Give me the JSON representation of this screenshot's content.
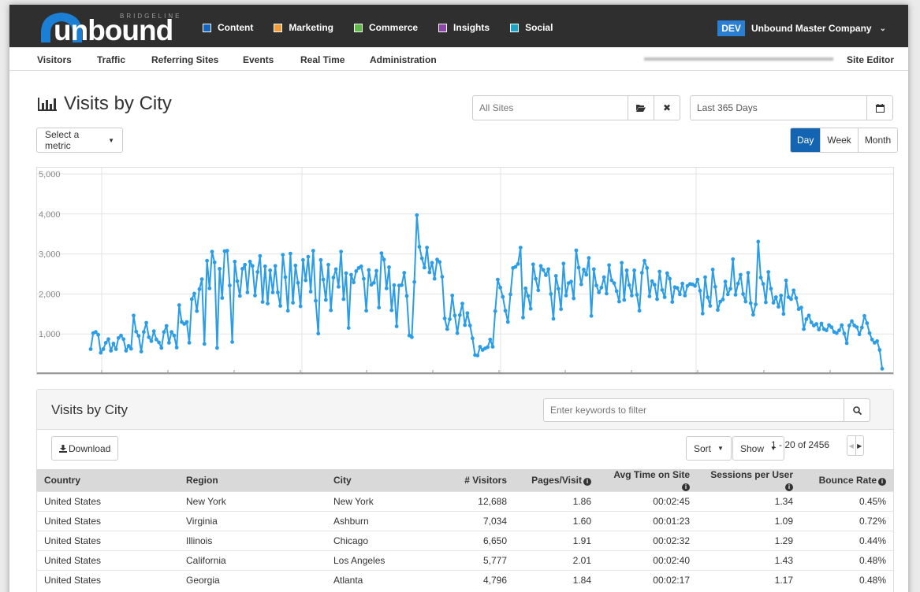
{
  "brand": {
    "name": "unbound",
    "sub": "BRIDGELINE"
  },
  "topnav": [
    {
      "label": "Content",
      "color": "#1565c0"
    },
    {
      "label": "Marketing",
      "color": "#f39c3c"
    },
    {
      "label": "Commerce",
      "color": "#5fba47"
    },
    {
      "label": "Insights",
      "color": "#8e44ad"
    },
    {
      "label": "Social",
      "color": "#1fa2c8"
    }
  ],
  "company": {
    "badge": "DEV",
    "name": "Unbound Master Company"
  },
  "subnav": {
    "items": [
      "Visitors",
      "Traffic",
      "Referring Sites",
      "Events",
      "Real Time",
      "Administration"
    ],
    "right": "Site Editor"
  },
  "page": {
    "title": "Visits by City"
  },
  "filters": {
    "sites_placeholder": "All Sites",
    "date_range": "Last 365 Days",
    "metric_label": "Select a metric",
    "granularity": [
      "Day",
      "Week",
      "Month"
    ],
    "granularity_selected": "Day"
  },
  "chart_data": {
    "type": "line",
    "ylim": [
      0,
      5000
    ],
    "yticks": [
      "1,000",
      "2,000",
      "3,000",
      "4,000",
      "5,000"
    ],
    "series": [
      {
        "values": [
          620,
          1020,
          1050,
          980,
          530,
          620,
          780,
          870,
          580,
          760,
          620,
          900,
          960,
          870,
          580,
          700,
          630,
          1460,
          1060,
          950,
          560,
          1050,
          1280,
          920,
          820,
          1070,
          860,
          790,
          650,
          1050,
          1200,
          780,
          1050,
          960,
          660,
          1720,
          1300,
          1250,
          1300,
          780,
          1870,
          2010,
          1570,
          2120,
          2370,
          750,
          2830,
          2140,
          3060,
          2790,
          650,
          2630,
          1900,
          3070,
          3080,
          2210,
          800,
          2810,
          2320,
          1950,
          2630,
          2730,
          2040,
          2810,
          2700,
          1960,
          2550,
          2950,
          1800,
          2690,
          1760,
          2590,
          2040,
          2700,
          2040,
          1700,
          2980,
          2420,
          1580,
          3010,
          1780,
          2710,
          2280,
          1690,
          2850,
          2340,
          2930,
          2060,
          3080,
          1830,
          1010,
          2850,
          2360,
          1850,
          2730,
          1590,
          2410,
          2620,
          2180,
          3060,
          1870,
          2520,
          1150,
          2480,
          2290,
          2570,
          2650,
          2690,
          2380,
          1580,
          2600,
          2230,
          2280,
          2580,
          1660,
          3020,
          2860,
          2140,
          2670,
          1590,
          2220,
          1190,
          2210,
          2220,
          2530,
          1950,
          960,
          920,
          2300,
          3970,
          3180,
          2890,
          2660,
          3160,
          2540,
          2780,
          2380,
          2860,
          2800,
          2430,
          1390,
          1120,
          1370,
          1960,
          1460,
          1020,
          1470,
          1760,
          1220,
          1520,
          1210,
          890,
          470,
          460,
          680,
          600,
          640,
          670,
          860,
          680,
          1570,
          2360,
          2160,
          1930,
          1580,
          1300,
          1990,
          2650,
          2680,
          2750,
          3160,
          1410,
          2140,
          1950,
          1630,
          2740,
          2380,
          2090,
          2700,
          2600,
          2470,
          2620,
          2000,
          1380,
          2450,
          2130,
          1620,
          2760,
          1960,
          2270,
          2310,
          1890,
          3090,
          2660,
          2240,
          2610,
          2480,
          2900,
          1450,
          2620,
          2210,
          2040,
          2160,
          2420,
          2010,
          2720,
          2340,
          2270,
          2070,
          1810,
          2780,
          1850,
          2590,
          2220,
          1960,
          2590,
          1980,
          1580,
          2530,
          2830,
          2650,
          1940,
          2320,
          2230,
          1870,
          2560,
          2100,
          1920,
          2520,
          2380,
          1800,
          2170,
          2150,
          1990,
          2260,
          1960,
          2200,
          2250,
          2240,
          2200,
          2360,
          2080,
          1510,
          2420,
          1920,
          1700,
          2610,
          2180,
          1600,
          1810,
          1860,
          2310,
          1990,
          2130,
          2870,
          1980,
          2260,
          2480,
          2000,
          1810,
          2530,
          1770,
          1480,
          1740,
          3310,
          2410,
          2250,
          1790,
          2550,
          2130,
          1780,
          1920,
          1680,
          1960,
          1500,
          2340,
          1920,
          1870,
          2090,
          1900,
          1620,
          1660,
          1120,
          1370,
          1460,
          1290,
          1210,
          1250,
          1110,
          1260,
          1120,
          1090,
          1220,
          1170,
          1050,
          1020,
          1090,
          1220,
          1010,
          770,
          1210,
          1320,
          1210,
          1170,
          990,
          1160,
          1450,
          1270,
          1020,
          860,
          780,
          820,
          600,
          130
        ]
      }
    ]
  },
  "table": {
    "title": "Visits by City",
    "filter_placeholder": "Enter keywords to filter",
    "download_label": "Download",
    "sort_label": "Sort",
    "show_label": "Show",
    "pager": "1 - 20 of 2456",
    "columns": [
      "Country",
      "Region",
      "City",
      "# Visitors",
      "Pages/Visit",
      "Avg Time on Site",
      "Sessions per User",
      "Bounce Rate"
    ],
    "rows": [
      [
        "United States",
        "New York",
        "New York",
        "12,688",
        "1.86",
        "00:02:45",
        "1.34",
        "0.45%"
      ],
      [
        "United States",
        "Virginia",
        "Ashburn",
        "7,034",
        "1.60",
        "00:01:23",
        "1.09",
        "0.72%"
      ],
      [
        "United States",
        "Illinois",
        "Chicago",
        "6,650",
        "1.91",
        "00:02:32",
        "1.29",
        "0.44%"
      ],
      [
        "United States",
        "California",
        "Los Angeles",
        "5,777",
        "2.01",
        "00:02:40",
        "1.43",
        "0.48%"
      ],
      [
        "United States",
        "Georgia",
        "Atlanta",
        "4,796",
        "1.84",
        "00:02:17",
        "1.17",
        "0.48%"
      ]
    ]
  }
}
